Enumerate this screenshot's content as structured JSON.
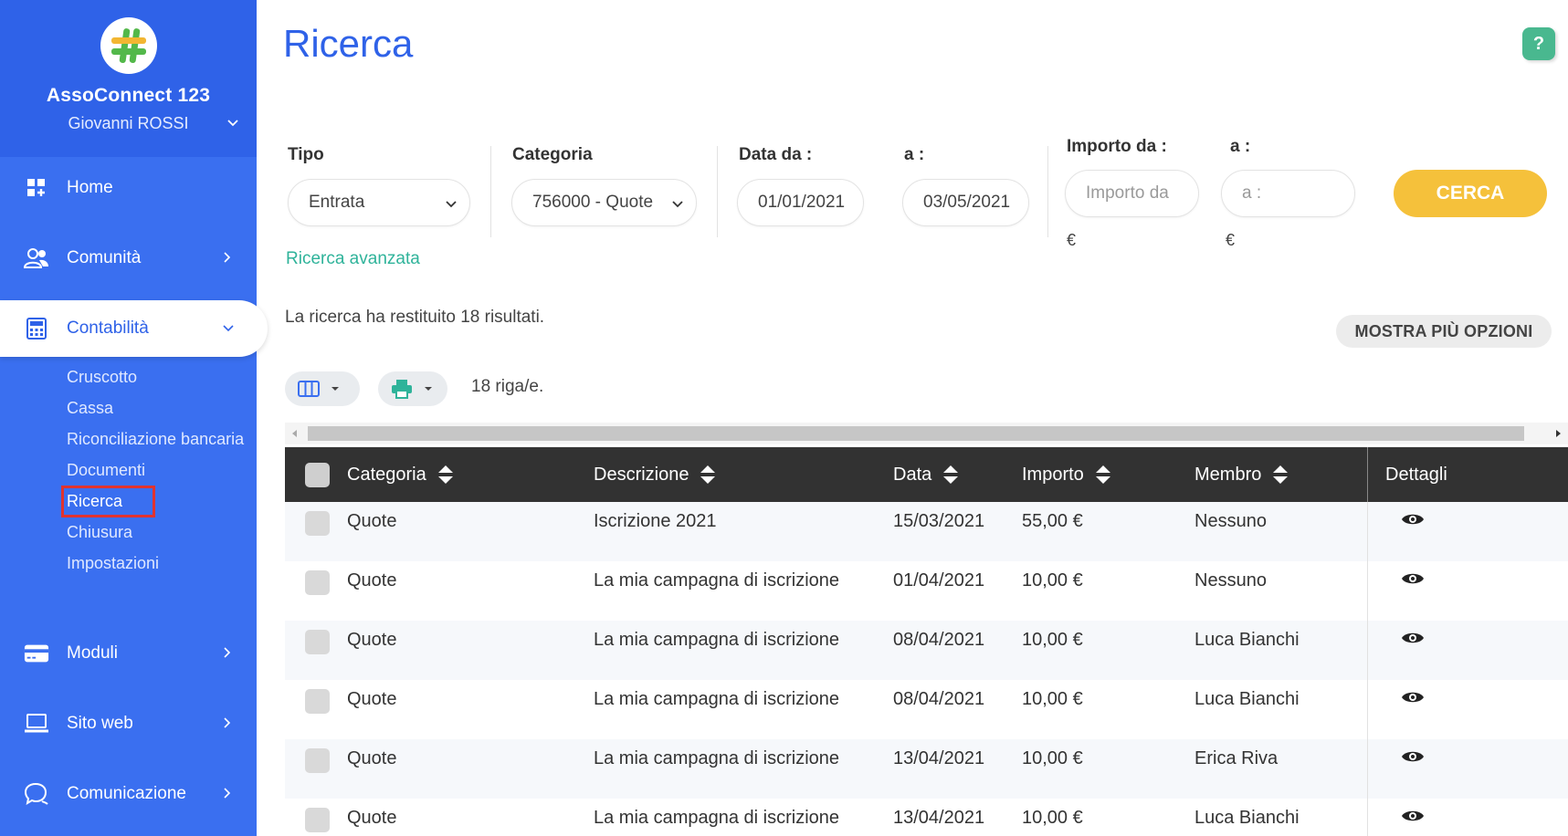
{
  "sidebar": {
    "brand_name": "AssoConnect 123",
    "user_name": "Giovanni ROSSI",
    "nav": [
      {
        "label": "Home",
        "icon": "dashboard-icon"
      },
      {
        "label": "Comunità",
        "icon": "users-icon"
      },
      {
        "label": "Contabilità",
        "icon": "calculator-icon"
      },
      {
        "label": "Moduli",
        "icon": "credit-card-icon"
      },
      {
        "label": "Sito web",
        "icon": "laptop-icon"
      },
      {
        "label": "Comunicazione",
        "icon": "chat-icon"
      }
    ],
    "subnav": [
      "Cruscotto",
      "Cassa",
      "Riconciliazione bancaria",
      "Documenti",
      "Ricerca",
      "Chiusura",
      "Impostazioni"
    ]
  },
  "page": {
    "title": "Ricerca",
    "help_label": "?"
  },
  "filters": {
    "tipo_label": "Tipo",
    "tipo_value": "Entrata",
    "categoria_label": "Categoria",
    "categoria_value": "756000 - Quote",
    "data_da_label": "Data da :",
    "data_da_value": "01/01/2021",
    "data_a_label": "a :",
    "data_a_value": "03/05/2021",
    "importo_da_label": "Importo da :",
    "importo_da_placeholder": "Importo da",
    "importo_a_label": "a :",
    "importo_a_placeholder": "a :",
    "currency": "€",
    "search_button": "CERCA",
    "advanced_link": "Ricerca avanzata"
  },
  "results": {
    "summary": "La ricerca ha restituito 18 risultati.",
    "more_options": "MOSTRA PIÙ OPZIONI",
    "rows_count": "18 riga/e."
  },
  "table": {
    "columns": [
      "Categoria",
      "Descrizione",
      "Data",
      "Importo",
      "Membro",
      "Dettagli"
    ],
    "rows": [
      {
        "categoria": "Quote",
        "descrizione": "Iscrizione 2021",
        "data": "15/03/2021",
        "importo": "55,00 €",
        "membro": "Nessuno"
      },
      {
        "categoria": "Quote",
        "descrizione": "La mia campagna di iscrizione",
        "data": "01/04/2021",
        "importo": "10,00 €",
        "membro": "Nessuno"
      },
      {
        "categoria": "Quote",
        "descrizione": "La mia campagna di iscrizione",
        "data": "08/04/2021",
        "importo": "10,00 €",
        "membro": "Luca Bianchi"
      },
      {
        "categoria": "Quote",
        "descrizione": "La mia campagna di iscrizione",
        "data": "08/04/2021",
        "importo": "10,00 €",
        "membro": "Luca Bianchi"
      },
      {
        "categoria": "Quote",
        "descrizione": "La mia campagna di iscrizione",
        "data": "13/04/2021",
        "importo": "10,00 €",
        "membro": "Erica Riva"
      },
      {
        "categoria": "Quote",
        "descrizione": "La mia campagna di iscrizione",
        "data": "13/04/2021",
        "importo": "10,00 €",
        "membro": "Luca Bianchi"
      }
    ]
  },
  "colors": {
    "sidebar": "#3a6ff0",
    "brand": "#2f62e8",
    "accent_yellow": "#f5c13b",
    "link_green": "#2fb39a",
    "help_green": "#49b88f",
    "table_header": "#323232"
  }
}
